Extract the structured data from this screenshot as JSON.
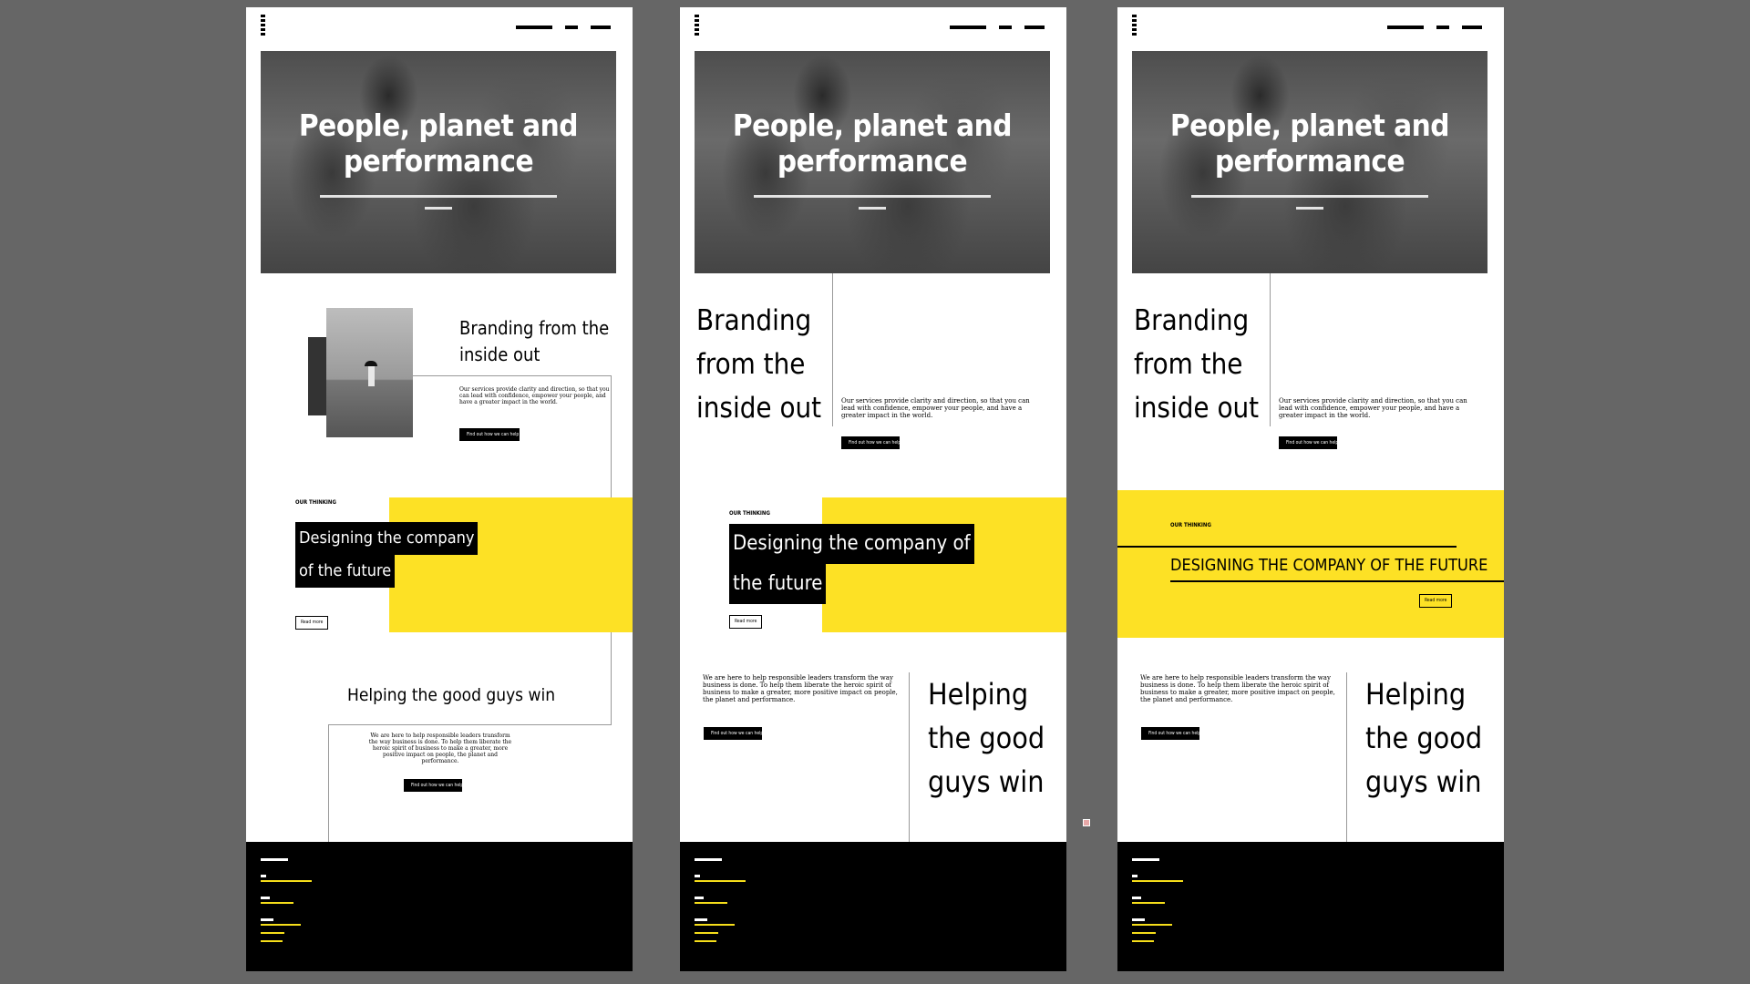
{
  "hero": {
    "title_line1": "People, planet and",
    "title_line2": "performance"
  },
  "branding": {
    "heading_line1": "Branding from the",
    "heading_line2": "inside out",
    "tall_line1": "Branding",
    "tall_line2": "from the",
    "tall_line3": "inside out",
    "body": "Our services provide clarity and direction, so that you can lead with confidence, empower your people, and have a greater impact in the world.",
    "cta": "Find out how we can help"
  },
  "thinking": {
    "eyebrow": "OUR THINKING",
    "title_a1": "Designing the company",
    "title_a2": "of the future",
    "title_b1": "Designing the company of",
    "title_b2": "the future",
    "title_c": "DESIGNING THE COMPANY OF THE FUTURE",
    "read_more": "Read more"
  },
  "helping": {
    "heading": "Helping the good guys win",
    "tall_line1": "Helping",
    "tall_line2": "the good",
    "tall_line3": "guys win",
    "body": "We are here to help responsible leaders transform the way business is done. To help them liberate the heroic spirit of business to make a greater, more positive impact on people, the planet and performance.",
    "cta": "Find out how we can help"
  },
  "colors": {
    "accent": "#fde125",
    "canvas": "#666666",
    "footer": "#000000"
  },
  "icons": [
    "logo-icon"
  ]
}
